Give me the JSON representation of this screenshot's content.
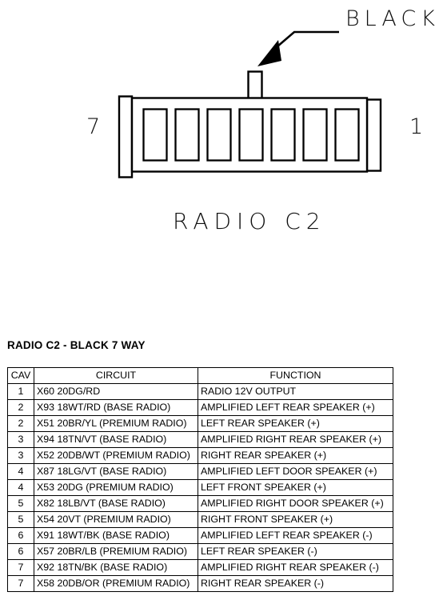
{
  "diagram": {
    "color_label": "BLACK",
    "left_pin_number": "7",
    "right_pin_number": "1",
    "caption": "RADIO C2",
    "cavity_count": 7
  },
  "table_title": "RADIO C2 - BLACK 7 WAY",
  "table": {
    "headers": [
      "CAV",
      "CIRCUIT",
      "FUNCTION"
    ],
    "rows": [
      [
        "1",
        "X60 20DG/RD",
        "RADIO 12V OUTPUT"
      ],
      [
        "2",
        "X93 18WT/RD (BASE RADIO)",
        "AMPLIFIED LEFT REAR SPEAKER (+)"
      ],
      [
        "2",
        "X51 20BR/YL (PREMIUM RADIO)",
        "LEFT REAR SPEAKER (+)"
      ],
      [
        "3",
        "X94 18TN/VT (BASE RADIO)",
        "AMPLIFIED RIGHT REAR SPEAKER (+)"
      ],
      [
        "3",
        "X52 20DB/WT (PREMIUM RADIO)",
        "RIGHT REAR SPEAKER (+)"
      ],
      [
        "4",
        "X87 18LG/VT (BASE RADIO)",
        "AMPLIFIED LEFT DOOR SPEAKER (+)"
      ],
      [
        "4",
        "X53 20DG (PREMIUM RADIO)",
        "LEFT FRONT SPEAKER (+)"
      ],
      [
        "5",
        "X82 18LB/VT (BASE RADIO)",
        "AMPLIFIED RIGHT DOOR SPEAKER (+)"
      ],
      [
        "5",
        "X54 20VT (PREMIUM RADIO)",
        "RIGHT FRONT SPEAKER (+)"
      ],
      [
        "6",
        "X91 18WT/BK (BASE RADIO)",
        "AMPLIFIED LEFT REAR SPEAKER (-)"
      ],
      [
        "6",
        "X57 20BR/LB (PREMIUM RADIO)",
        "LEFT REAR SPEAKER (-)"
      ],
      [
        "7",
        "X92 18TN/BK (BASE RADIO)",
        "AMPLIFIED RIGHT REAR SPEAKER (-)"
      ],
      [
        "7",
        "X58 20DB/OR (PREMIUM RADIO)",
        "RIGHT REAR SPEAKER (-)"
      ]
    ]
  }
}
